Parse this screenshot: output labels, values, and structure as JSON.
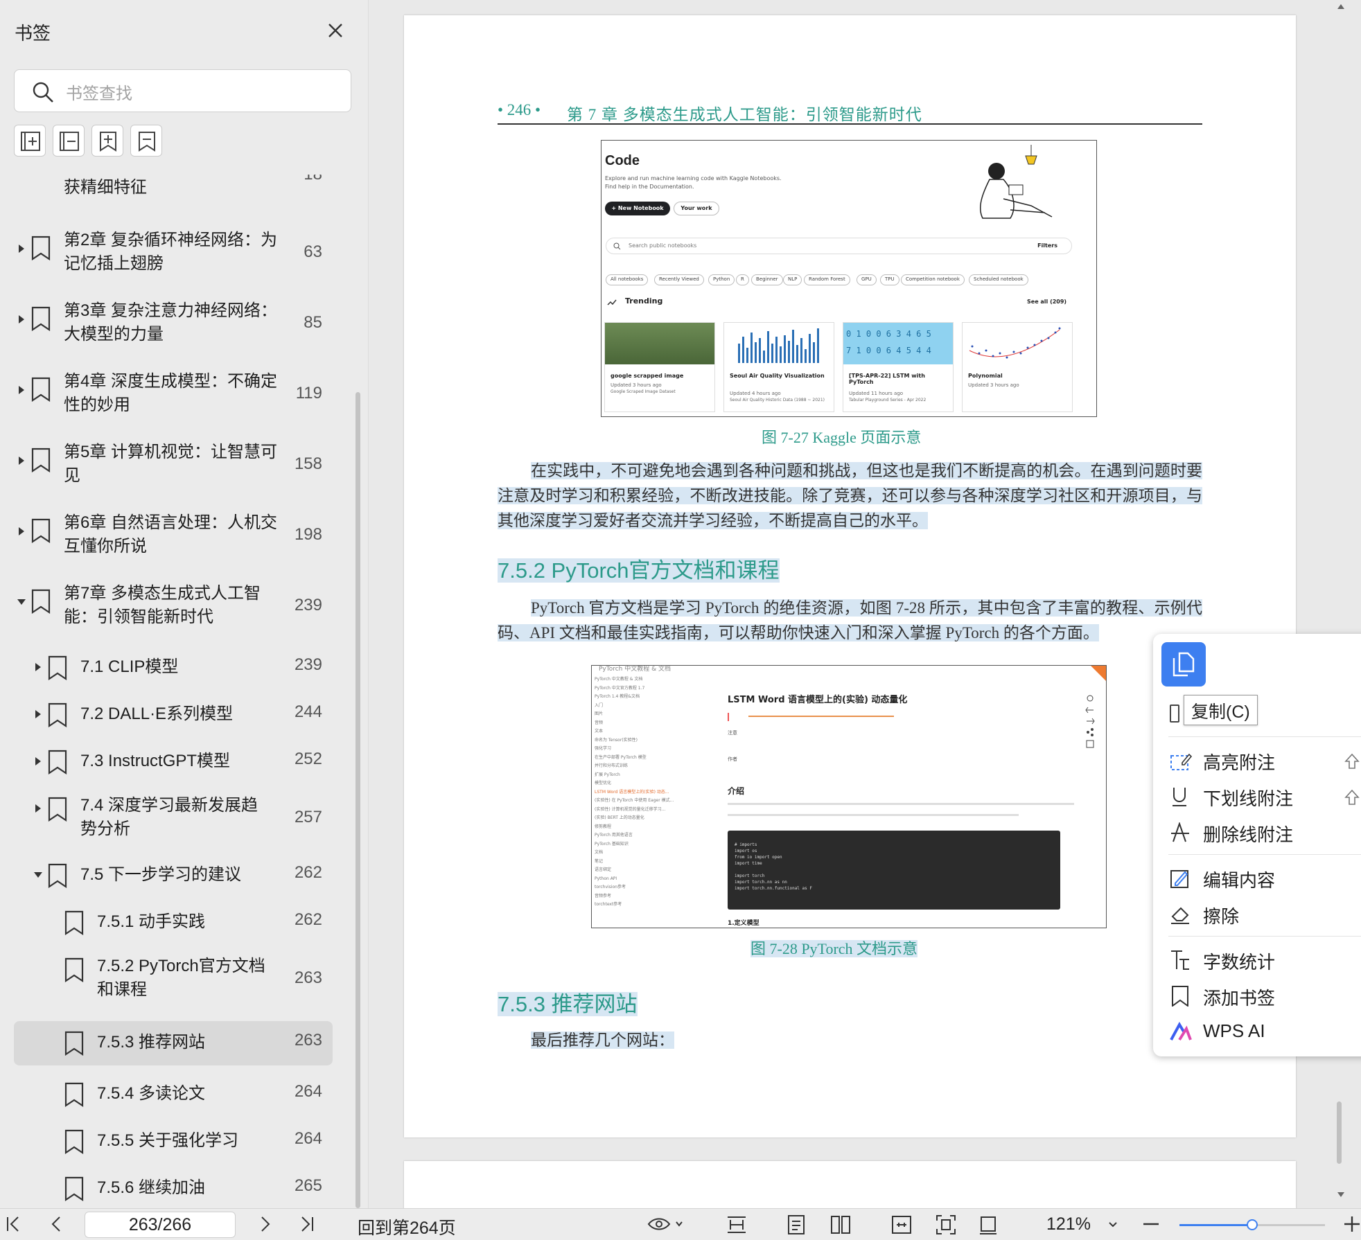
{
  "sidebar": {
    "title": "书签",
    "search_placeholder": "书签查找",
    "tools": [
      "expand-all-icon",
      "collapse-all-icon",
      "add-bookmark-icon",
      "bookmark-icon"
    ],
    "partial_item": {
      "label": "获精细特征",
      "page": "18"
    },
    "items": [
      {
        "label1": "第2章   复杂循环神经网络：为",
        "label2": "记忆插上翅膀",
        "page": "63"
      },
      {
        "label1": "第3章   复杂注意力神经网络：",
        "label2": "大模型的力量",
        "page": "85"
      },
      {
        "label1": "第4章   深度生成模型：不确定",
        "label2": "性的妙用",
        "page": "119"
      },
      {
        "label1": "第5章   计算机视觉：让智慧可",
        "label2": "见",
        "page": "158"
      },
      {
        "label1": "第6章   自然语言处理：人机交",
        "label2": "互懂你所说",
        "page": "198"
      },
      {
        "label1": "第7章   多模态生成式人工智",
        "label2": "能：引领智能新时代",
        "page": "239"
      }
    ],
    "sub_items": [
      {
        "label1": "7.1    CLIP模型",
        "label2": "",
        "page": "239"
      },
      {
        "label1": "7.2    DALL·E系列模型",
        "label2": "",
        "page": "244"
      },
      {
        "label1": "7.3    InstructGPT模型",
        "label2": "",
        "page": "252"
      },
      {
        "label1": "7.4    深度学习最新发展趋",
        "label2": "势分析",
        "page": "257"
      },
      {
        "label1": "7.5    下一步学习的建议",
        "label2": "",
        "page": "262"
      }
    ],
    "leaf_items": [
      {
        "label1": "7.5.1    动手实践",
        "label2": "",
        "page": "262"
      },
      {
        "label1": "7.5.2    PyTorch官方文档",
        "label2": "和课程",
        "page": "263"
      },
      {
        "label1": "7.5.3    推荐网站",
        "label2": "",
        "page": "263"
      },
      {
        "label1": "7.5.4    多读论文",
        "label2": "",
        "page": "264"
      },
      {
        "label1": "7.5.5    关于强化学习",
        "label2": "",
        "page": "264"
      },
      {
        "label1": "7.5.6    继续加油",
        "label2": "",
        "page": "265"
      }
    ]
  },
  "page": {
    "header_pn": "• 246 •",
    "header_ch": "第 7 章    多模态生成式人工智能：引领智能新时代",
    "fig1": {
      "title": "Code",
      "sub1": "Explore and run machine learning code with Kaggle Notebooks.",
      "sub2": "Find help in the Documentation.",
      "new_btn": "+ New Notebook",
      "your_btn": "Your work",
      "search_ph": "Search public notebooks",
      "filters": "Filters",
      "chips": [
        "All notebooks",
        "Recently Viewed",
        "Python",
        "R",
        "Beginner",
        "NLP",
        "Random Forest",
        "GPU",
        "TPU",
        "Competition notebook",
        "Scheduled notebook"
      ],
      "trending": "Trending",
      "see_all": "See all (209)",
      "cards": [
        {
          "t": "google scrapped image",
          "s1": "Updated 3 hours ago",
          "s2": "Google Scraped Image Dataset"
        },
        {
          "t": "Seoul Air Quality Visualization",
          "s1": "Updated 4 hours ago",
          "s2": "Seoul Air Quality Historic Data (1988 ~ 2021)"
        },
        {
          "t": "[TPS-APR-22] LSTM with PyTorch",
          "s1": "Updated 11 hours ago",
          "s2": "Tabular Playground Series - Apr 2022"
        },
        {
          "t": "Polynomial",
          "s1": "Updated 3 hours ago",
          "s2": ""
        }
      ],
      "digits1": "0 1 0 0 6 3 4 6 5",
      "digits2": "7 1 0 0 6 4 5 4 4"
    },
    "cap1": "图 7-27    Kaggle 页面示意",
    "para1": "在实践中，不可避免地会遇到各种问题和挑战，但这也是我们不断提高的机会。在遇到问题时要注意及时学习和积累经验，不断改进技能。除了竞赛，还可以参与各种深度学习社区和开源项目，与其他深度学习爱好者交流并学习经验，不断提高自己的水平。",
    "h752": "7.5.2    PyTorch官方文档和课程",
    "para2": "PyTorch 官方文档是学习 PyTorch 的绝佳资源，如图 7-28 所示，其中包含了丰富的教程、示例代码、API 文档和最佳实践指南，可以帮助你快速入门和深入掌握 PyTorch 的各个方面。",
    "fig2": {
      "top": "PyTorch 中文教程 & 文档",
      "title": "LSTM Word 语言模型上的(实验) 动态量化",
      "intro": "介绍",
      "note": "注意",
      "author": "作者",
      "section": "1.定义模型",
      "code": [
        "# imports",
        "import os",
        "from io import open",
        "import time",
        "",
        "import torch",
        "import torch.nn as nn",
        "import torch.nn.functional as F"
      ],
      "nav": [
        "PyTorch 中文教程 & 文档",
        "PyTorch 中文官方教程 1.7",
        "PyTorch 1.4 教程&文档",
        "入门",
        "图片",
        "音频",
        "文本",
        "命名为 Tensor(实验性)",
        "强化学习",
        "在生产中部署 PyTorch 模型",
        "并行和分布式训练",
        "扩展 PyTorch",
        "模型优化",
        "LSTM Word 语言模型上的(实验) 动态...",
        "(实验性) 在 PyTorch 中使用 Eager 模式...",
        "(实验性) 计算机视觉的量化迁移学习...",
        "(实验) BERT 上的动态量化",
        "修剪教程",
        "PyTorch 用其他语言",
        "PyTorch 基础知识",
        "文档",
        "笔记",
        "语言绑定",
        "Python API",
        "torchvision参考",
        "音频参考",
        "torchtext参考"
      ]
    },
    "cap2": "图 7-28    PyTorch 文档示意",
    "h753": "7.5.3    推荐网站",
    "para3": "最后推荐几个网站："
  },
  "context_menu": {
    "tooltip": "复制(C)",
    "items": [
      {
        "icon": "highlight-note-icon",
        "label": "高亮附注"
      },
      {
        "icon": "underline-note-icon",
        "label": "下划线附注"
      },
      {
        "icon": "strikethrough-note-icon",
        "label": "删除线附注"
      },
      {
        "icon": "edit-content-icon",
        "label": "编辑内容"
      },
      {
        "icon": "eraser-icon",
        "label": "擦除"
      },
      {
        "icon": "word-count-icon",
        "label": "字数统计"
      },
      {
        "icon": "bookmark-icon",
        "label": "添加书签"
      },
      {
        "icon": "wps-ai-icon",
        "label": "WPS AI"
      }
    ]
  },
  "statusbar": {
    "page_input": "263/266",
    "back_to": "回到第264页",
    "zoom": "121%",
    "zoom_fraction": 0.5
  },
  "colors": {
    "accent": "#3d7ff0",
    "teal": "#2c9a8a",
    "highlight": "#d7e6f3"
  }
}
